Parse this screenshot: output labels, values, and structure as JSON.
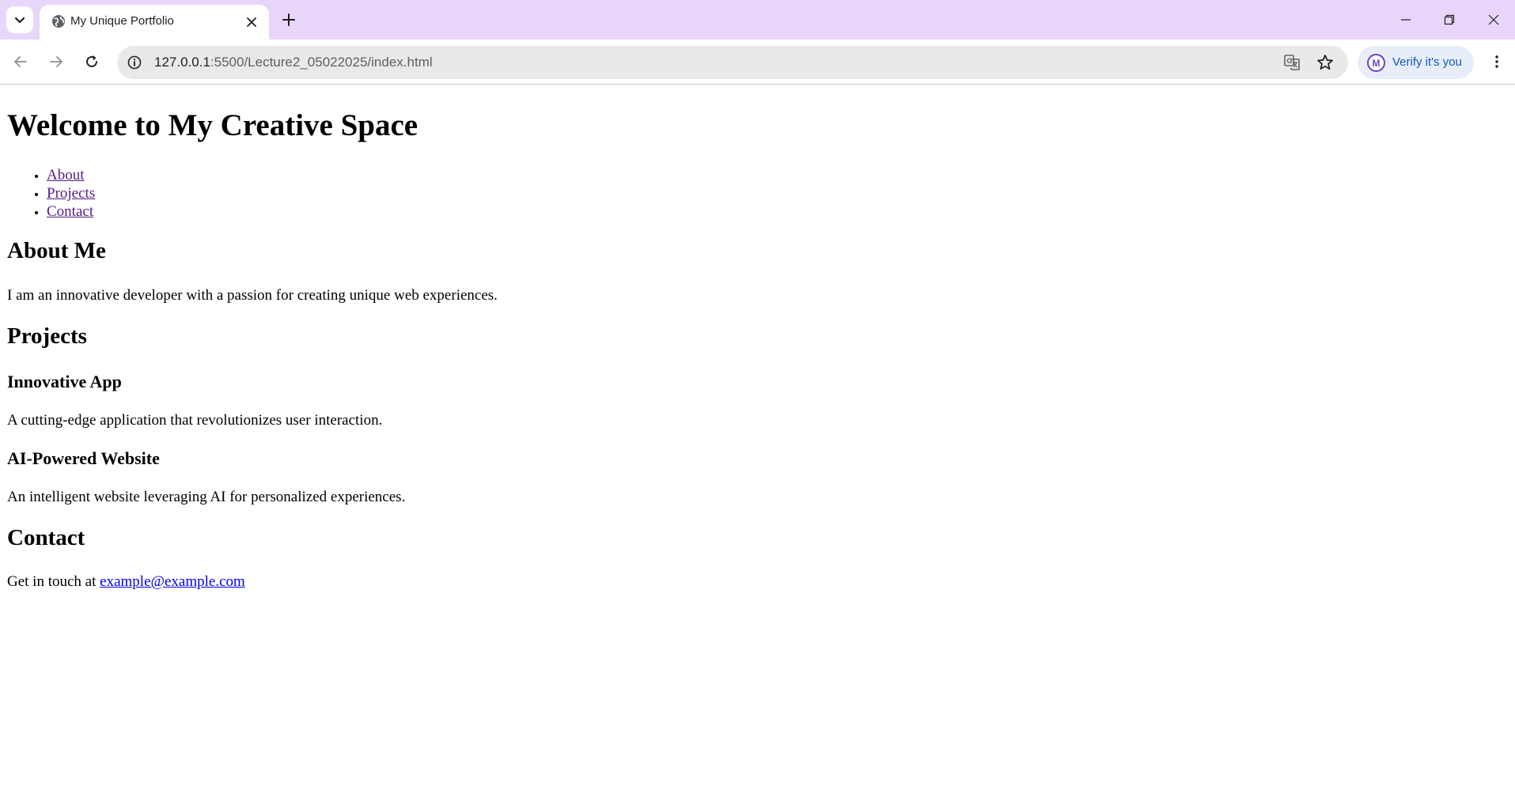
{
  "browser": {
    "tab_title": "My Unique Portfolio",
    "url_host": "127.0.0.1",
    "url_rest": ":5500/Lecture2_05022025/index.html",
    "verify_label": "Verify it's you",
    "avatar_letter": "M",
    "colors": {
      "tabstrip": "#e8d6fa",
      "verify_bg": "#e8eef9",
      "verify_text": "#0b57d0"
    }
  },
  "page": {
    "heading": "Welcome to My Creative Space",
    "nav": [
      {
        "label": "About"
      },
      {
        "label": "Projects"
      },
      {
        "label": "Contact"
      }
    ],
    "about": {
      "title": "About Me",
      "text": "I am an innovative developer with a passion for creating unique web experiences."
    },
    "projects": {
      "title": "Projects",
      "items": [
        {
          "name": "Innovative App",
          "description": "A cutting-edge application that revolutionizes user interaction."
        },
        {
          "name": "AI-Powered Website",
          "description": "An intelligent website leveraging AI for personalized experiences."
        }
      ]
    },
    "contact": {
      "title": "Contact",
      "prefix": "Get in touch at",
      "email": "example@example.com"
    }
  }
}
